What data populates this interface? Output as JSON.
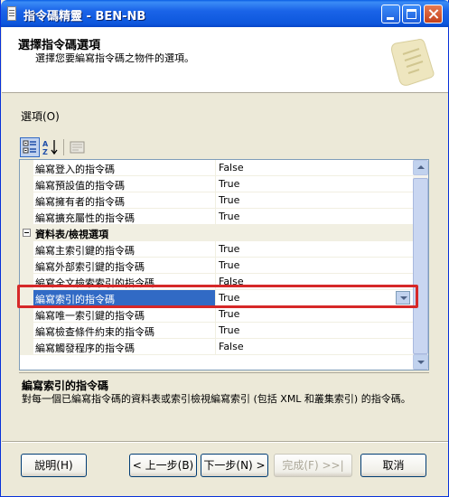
{
  "window": {
    "title": "指令碼精靈 - BEN-NB"
  },
  "header": {
    "title": "選擇指令碼選項",
    "description": "選擇您要編寫指令碼之物件的選項。"
  },
  "options_label": "選項(O)",
  "grid": {
    "rows": [
      {
        "type": "prop",
        "name": "編寫登入的指令碼",
        "value": "False"
      },
      {
        "type": "prop",
        "name": "編寫預設值的指令碼",
        "value": "True"
      },
      {
        "type": "prop",
        "name": "編寫擁有者的指令碼",
        "value": "True"
      },
      {
        "type": "prop",
        "name": "編寫擴充屬性的指令碼",
        "value": "True"
      },
      {
        "type": "category",
        "name": "資料表/檢視選項",
        "value": ""
      },
      {
        "type": "prop",
        "name": "編寫主索引鍵的指令碼",
        "value": "True"
      },
      {
        "type": "prop",
        "name": "編寫外部索引鍵的指令碼",
        "value": "True"
      },
      {
        "type": "prop",
        "name": "編寫全文檢索索引的指令碼",
        "value": "False"
      },
      {
        "type": "prop",
        "name": "編寫索引的指令碼",
        "value": "True",
        "selected": true
      },
      {
        "type": "prop",
        "name": "編寫唯一索引鍵的指令碼",
        "value": "True"
      },
      {
        "type": "prop",
        "name": "編寫檢查條件約束的指令碼",
        "value": "True"
      },
      {
        "type": "prop",
        "name": "編寫觸發程序的指令碼",
        "value": "False"
      }
    ]
  },
  "description": {
    "title": "編寫索引的指令碼",
    "text": "對每一個已編寫指令碼的資料表或索引檢視編寫索引 (包括 XML 和叢集索引) 的指令碼。"
  },
  "buttons": {
    "help": "說明(H)",
    "back": "< 上一步(B)",
    "next": "下一步(N) >",
    "finish": "完成(F) >>|",
    "cancel": "取消"
  },
  "icons": {
    "categorized": "categorized-icon",
    "alphabetical": "sort-az-icon",
    "property_pages": "property-pages-icon",
    "wizard": "scroll-icon"
  },
  "colors": {
    "titlebar": "#0a5ee4",
    "selection": "#316ac5",
    "highlight_box": "#d62828"
  }
}
